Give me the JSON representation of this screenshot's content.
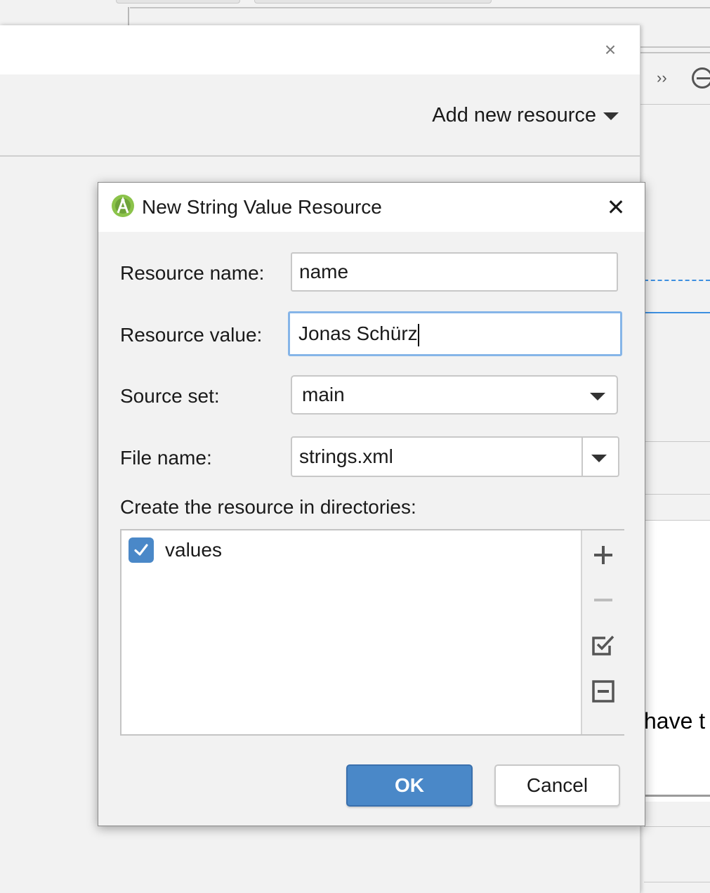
{
  "background": {
    "snippet_text": "have t"
  },
  "resource_manager": {
    "add_new_resource_label": "Add new resource",
    "close_glyph": "×"
  },
  "dialog": {
    "title": "New String Value Resource",
    "close_glyph": "✕",
    "fields": {
      "resource_name": {
        "label": "Resource name:",
        "value": "name"
      },
      "resource_value": {
        "label": "Resource value:",
        "value": "Jonas Schürz"
      },
      "source_set": {
        "label": "Source set:",
        "value": "main"
      },
      "file_name": {
        "label": "File name:",
        "value": "strings.xml"
      }
    },
    "directories": {
      "label": "Create the resource in directories:",
      "items": [
        {
          "label": "values",
          "checked": true
        }
      ],
      "toolbar": [
        "add-icon",
        "remove-icon",
        "check-all-icon",
        "uncheck-all-icon"
      ]
    },
    "buttons": {
      "ok": "OK",
      "cancel": "Cancel"
    }
  },
  "colors": {
    "accent": "#4a88c8",
    "focus_ring": "#86b5e8",
    "android_green": "#8bc34a"
  }
}
